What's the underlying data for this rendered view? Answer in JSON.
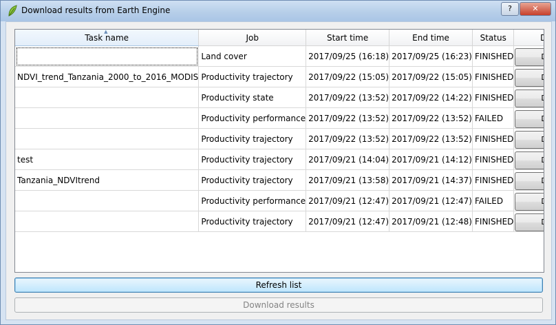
{
  "window": {
    "title": "Download results from Earth Engine",
    "help_label": "?",
    "close_label": "✕"
  },
  "table": {
    "headers": {
      "task_name": "Task name",
      "job": "Job",
      "start_time": "Start time",
      "end_time": "End time",
      "status": "Status",
      "details": "Details"
    },
    "rows": [
      {
        "task_name": "",
        "job": "Land cover",
        "start": "2017/09/25 (16:18)",
        "end": "2017/09/25 (16:23)",
        "status": "FINISHED",
        "details_label": "Details"
      },
      {
        "task_name": "NDVI_trend_Tanzania_2000_to_2016_MODIS",
        "job": "Productivity trajectory",
        "start": "2017/09/22 (15:05)",
        "end": "2017/09/22 (15:05)",
        "status": "FINISHED",
        "details_label": "Details"
      },
      {
        "task_name": "",
        "job": "Productivity state",
        "start": "2017/09/22 (13:52)",
        "end": "2017/09/22 (14:22)",
        "status": "FINISHED",
        "details_label": "Details"
      },
      {
        "task_name": "",
        "job": "Productivity performance",
        "start": "2017/09/22 (13:52)",
        "end": "2017/09/22 (13:52)",
        "status": "FAILED",
        "details_label": "Details"
      },
      {
        "task_name": "",
        "job": "Productivity trajectory",
        "start": "2017/09/22 (13:52)",
        "end": "2017/09/22 (13:52)",
        "status": "FINISHED",
        "details_label": "Details"
      },
      {
        "task_name": "test",
        "job": "Productivity trajectory",
        "start": "2017/09/21 (14:04)",
        "end": "2017/09/21 (14:12)",
        "status": "FINISHED",
        "details_label": "Details"
      },
      {
        "task_name": "Tanzania_NDVItrend",
        "job": "Productivity trajectory",
        "start": "2017/09/21 (13:58)",
        "end": "2017/09/21 (14:37)",
        "status": "FINISHED",
        "details_label": "Details"
      },
      {
        "task_name": "",
        "job": "Productivity performance",
        "start": "2017/09/21 (12:47)",
        "end": "2017/09/21 (12:47)",
        "status": "FAILED",
        "details_label": "Details"
      },
      {
        "task_name": "",
        "job": "Productivity trajectory",
        "start": "2017/09/21 (12:47)",
        "end": "2017/09/21 (12:48)",
        "status": "FINISHED",
        "details_label": "Details"
      }
    ]
  },
  "buttons": {
    "refresh_label": "Refresh list",
    "download_label": "Download results"
  }
}
